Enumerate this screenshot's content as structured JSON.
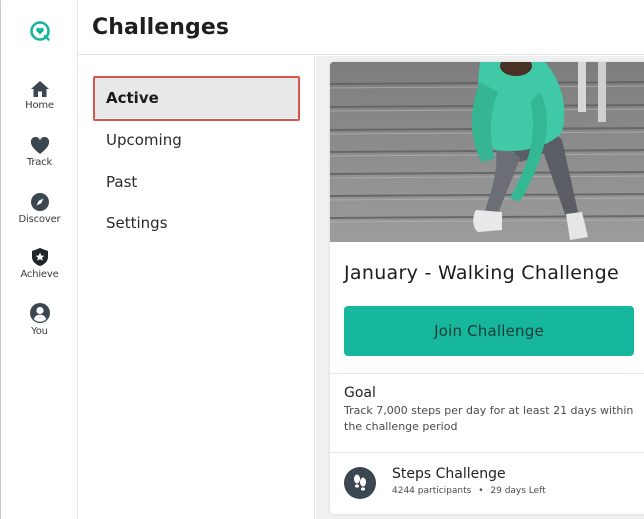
{
  "app": {
    "logo_icon": "app-logo-icon",
    "accent_color": "#17b79e",
    "highlight_color": "#d9534f"
  },
  "nav": {
    "items": [
      {
        "label": "Home",
        "icon": "home-icon"
      },
      {
        "label": "Track",
        "icon": "heart-icon"
      },
      {
        "label": "Discover",
        "icon": "compass-icon"
      },
      {
        "label": "Achieve",
        "icon": "shield-star-icon"
      },
      {
        "label": "You",
        "icon": "user-icon"
      }
    ]
  },
  "header": {
    "title": "Challenges"
  },
  "submenu": {
    "items": [
      {
        "label": "Active",
        "active": true
      },
      {
        "label": "Upcoming",
        "active": false
      },
      {
        "label": "Past",
        "active": false
      },
      {
        "label": "Settings",
        "active": false
      }
    ]
  },
  "challenge": {
    "title": "January - Walking Challenge",
    "join_label": "Join Challenge",
    "goal_label": "Goal",
    "goal_text": "Track 7,000 steps per day for at least 21 days within the challenge period",
    "type_title": "Steps Challenge",
    "participants": "4244 participants",
    "separator": "•",
    "days_left": "29 days Left",
    "type_icon": "footprints-icon"
  }
}
